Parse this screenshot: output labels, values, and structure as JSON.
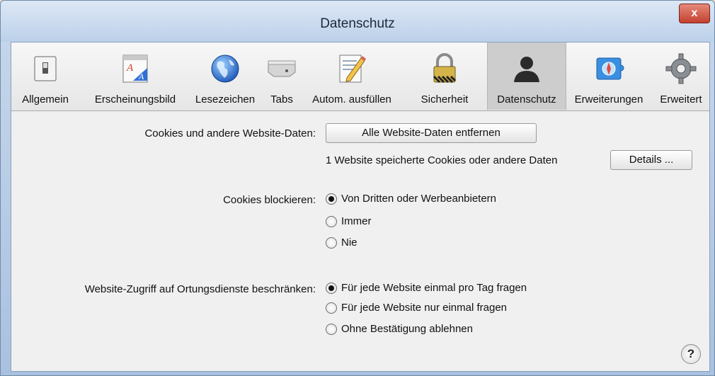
{
  "window": {
    "title": "Datenschutz",
    "close_label": "x"
  },
  "toolbar": {
    "items": [
      {
        "label": "Allgemein",
        "icon": "switch-icon"
      },
      {
        "label": "Erscheinungsbild",
        "icon": "font-appearance-icon"
      },
      {
        "label": "Lesezeichen",
        "icon": "globe-icon"
      },
      {
        "label": "Tabs",
        "icon": "tabs-icon"
      },
      {
        "label": "Autom. ausfüllen",
        "icon": "pencil-form-icon"
      },
      {
        "label": "Sicherheit",
        "icon": "lock-icon"
      },
      {
        "label": "Datenschutz",
        "icon": "person-silhouette-icon",
        "active": true
      },
      {
        "label": "Erweiterungen",
        "icon": "puzzle-compass-icon"
      },
      {
        "label": "Erweitert",
        "icon": "gear-icon"
      }
    ]
  },
  "cookies": {
    "label": "Cookies und andere Website-Daten:",
    "remove_button": "Alle Website-Daten entfernen",
    "info": "1 Website speicherte Cookies oder andere Daten",
    "details_button": "Details ..."
  },
  "block_cookies": {
    "label": "Cookies blockieren:",
    "options": [
      "Von Dritten oder Werbeanbietern",
      "Immer",
      "Nie"
    ],
    "selected": 0
  },
  "location": {
    "label": "Website-Zugriff auf Ortungsdienste beschränken:",
    "options": [
      "Für jede Website einmal pro Tag fragen",
      "Für jede Website nur einmal fragen",
      "Ohne Bestätigung ablehnen"
    ],
    "selected": 0
  },
  "help_label": "?"
}
